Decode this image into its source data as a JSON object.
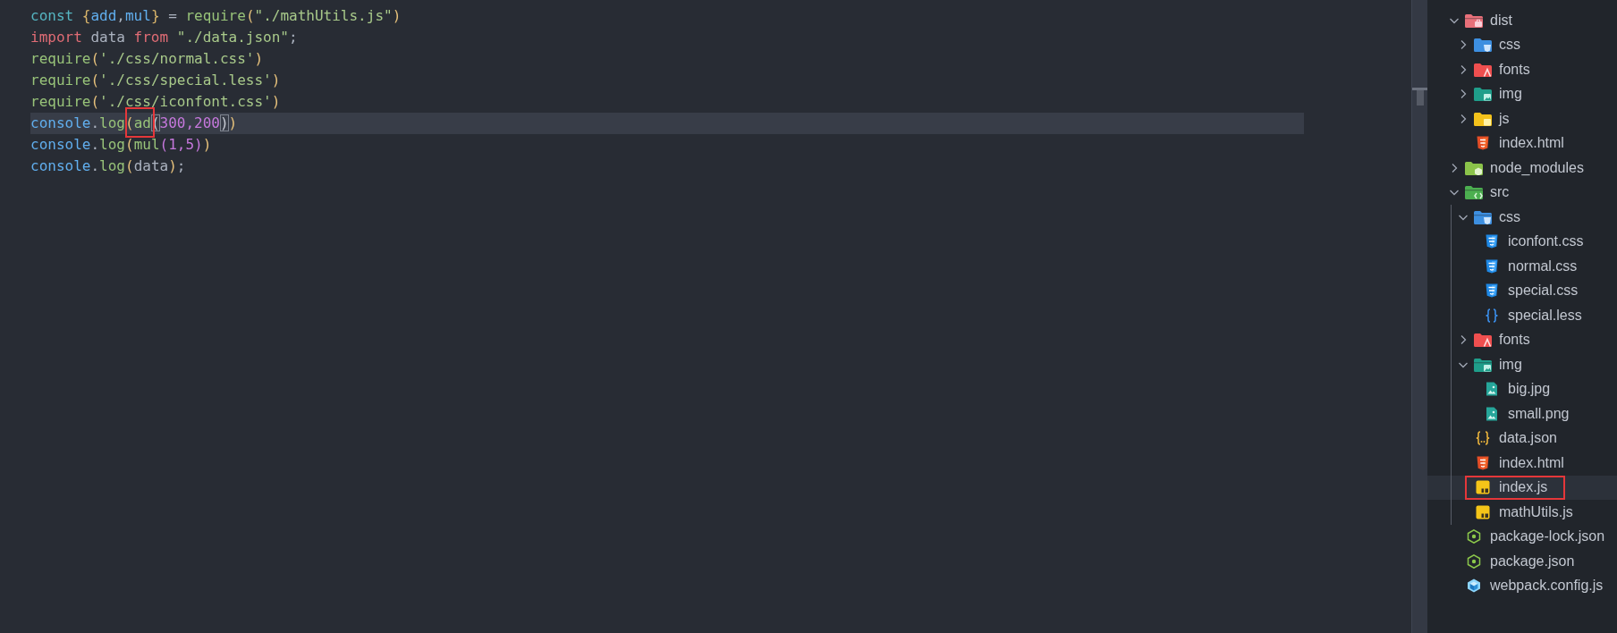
{
  "editor": {
    "lines": [
      {
        "current": false,
        "tokens": [
          {
            "text": "const",
            "kind": "keyword"
          },
          {
            "text": " {",
            "kind": "brace"
          },
          {
            "text": "add",
            "kind": "variable"
          },
          {
            "text": ",",
            "kind": "plain"
          },
          {
            "text": "mul",
            "kind": "variable"
          },
          {
            "text": "}",
            "kind": "brace"
          },
          {
            "text": " = ",
            "kind": "plain"
          },
          {
            "text": "require",
            "kind": "function"
          },
          {
            "text": "(",
            "kind": "bracket"
          },
          {
            "text": "\"./mathUtils.js\"",
            "kind": "string"
          },
          {
            "text": ")",
            "kind": "bracket"
          }
        ]
      },
      {
        "current": false,
        "tokens": [
          {
            "text": "import",
            "kind": "control"
          },
          {
            "text": " data ",
            "kind": "plain"
          },
          {
            "text": "from",
            "kind": "control"
          },
          {
            "text": " \"./data.json\"",
            "kind": "string"
          },
          {
            "text": ";",
            "kind": "plain"
          }
        ]
      },
      {
        "current": false,
        "tokens": [
          {
            "text": "require",
            "kind": "function"
          },
          {
            "text": "(",
            "kind": "bracket"
          },
          {
            "text": "'./css/normal.css'",
            "kind": "string"
          },
          {
            "text": ")",
            "kind": "bracket"
          }
        ]
      },
      {
        "current": false,
        "tokens": [
          {
            "text": "require",
            "kind": "function"
          },
          {
            "text": "(",
            "kind": "bracket"
          },
          {
            "text": "'./css/special.less'",
            "kind": "string"
          },
          {
            "text": ")",
            "kind": "bracket"
          }
        ]
      },
      {
        "current": false,
        "tokens": [
          {
            "text": "require",
            "kind": "function"
          },
          {
            "text": "(",
            "kind": "bracket"
          },
          {
            "text": "'./css/iconfont.css'",
            "kind": "string"
          },
          {
            "text": ")",
            "kind": "bracket"
          }
        ]
      },
      {
        "current": true,
        "tokens": [
          {
            "text": "console",
            "kind": "object"
          },
          {
            "text": ".",
            "kind": "plain"
          },
          {
            "text": "log",
            "kind": "function"
          },
          {
            "kind": "marked",
            "tokens": [
              {
                "text": "(",
                "kind": "bracket"
              },
              {
                "text": "ad",
                "kind": "function"
              }
            ]
          },
          {
            "text": "(",
            "kind": "pair"
          },
          {
            "text": "300,200",
            "kind": "number"
          },
          {
            "text": ")",
            "kind": "pair"
          },
          {
            "text": ")",
            "kind": "bracket"
          }
        ]
      },
      {
        "current": false,
        "tokens": [
          {
            "text": "console",
            "kind": "object"
          },
          {
            "text": ".",
            "kind": "plain"
          },
          {
            "text": "log",
            "kind": "function"
          },
          {
            "text": "(",
            "kind": "bracket"
          },
          {
            "text": "mul",
            "kind": "function"
          },
          {
            "text": "(",
            "kind": "bracket2"
          },
          {
            "text": "1,5",
            "kind": "number"
          },
          {
            "text": ")",
            "kind": "bracket2"
          },
          {
            "text": ")",
            "kind": "bracket"
          }
        ]
      },
      {
        "current": false,
        "tokens": [
          {
            "text": "console",
            "kind": "object"
          },
          {
            "text": ".",
            "kind": "plain"
          },
          {
            "text": "log",
            "kind": "function"
          },
          {
            "text": "(",
            "kind": "bracket"
          },
          {
            "text": "data",
            "kind": "plain"
          },
          {
            "text": ")",
            "kind": "bracket"
          },
          {
            "text": ";",
            "kind": "plain"
          }
        ]
      }
    ]
  },
  "explorer": {
    "items": [
      {
        "name": "dist",
        "kind": "output",
        "expanded": true,
        "selected": false,
        "marked": false,
        "children": [
          {
            "name": "css",
            "kind": "styles",
            "expanded": false,
            "selected": false,
            "marked": false
          },
          {
            "name": "fonts",
            "kind": "fonts",
            "expanded": false,
            "selected": false,
            "marked": false
          },
          {
            "name": "img",
            "kind": "images",
            "expanded": false,
            "selected": false,
            "marked": false
          },
          {
            "name": "js",
            "kind": "scripts",
            "expanded": false,
            "selected": false,
            "marked": false
          },
          {
            "name": "index.html",
            "kind": "html",
            "selected": false,
            "marked": false
          }
        ]
      },
      {
        "name": "node_modules",
        "kind": "packages",
        "expanded": false,
        "selected": false,
        "marked": false
      },
      {
        "name": "src",
        "kind": "source",
        "expanded": true,
        "selected": false,
        "marked": false,
        "children": [
          {
            "name": "css",
            "kind": "styles",
            "expanded": true,
            "selected": false,
            "marked": false,
            "children": [
              {
                "name": "iconfont.css",
                "kind": "css",
                "selected": false,
                "marked": false
              },
              {
                "name": "normal.css",
                "kind": "css",
                "selected": false,
                "marked": false
              },
              {
                "name": "special.css",
                "kind": "css",
                "selected": false,
                "marked": false
              },
              {
                "name": "special.less",
                "kind": "less",
                "selected": false,
                "marked": false
              }
            ]
          },
          {
            "name": "fonts",
            "kind": "fonts",
            "expanded": false,
            "selected": false,
            "marked": false
          },
          {
            "name": "img",
            "kind": "images",
            "expanded": true,
            "selected": false,
            "marked": false,
            "children": [
              {
                "name": "big.jpg",
                "kind": "picture",
                "selected": false,
                "marked": false
              },
              {
                "name": "small.png",
                "kind": "picture",
                "selected": false,
                "marked": false
              }
            ]
          },
          {
            "name": "data.json",
            "kind": "json",
            "selected": false,
            "marked": false
          },
          {
            "name": "index.html",
            "kind": "html",
            "selected": false,
            "marked": false
          },
          {
            "name": "index.js",
            "kind": "javascript",
            "selected": true,
            "marked": true
          },
          {
            "name": "mathUtils.js",
            "kind": "javascript",
            "selected": false,
            "marked": false
          }
        ]
      },
      {
        "name": "package-lock.json",
        "kind": "node",
        "selected": false,
        "marked": false
      },
      {
        "name": "package.json",
        "kind": "node",
        "selected": false,
        "marked": false
      },
      {
        "name": "webpack.config.js",
        "kind": "webpack",
        "selected": false,
        "marked": false
      }
    ]
  }
}
